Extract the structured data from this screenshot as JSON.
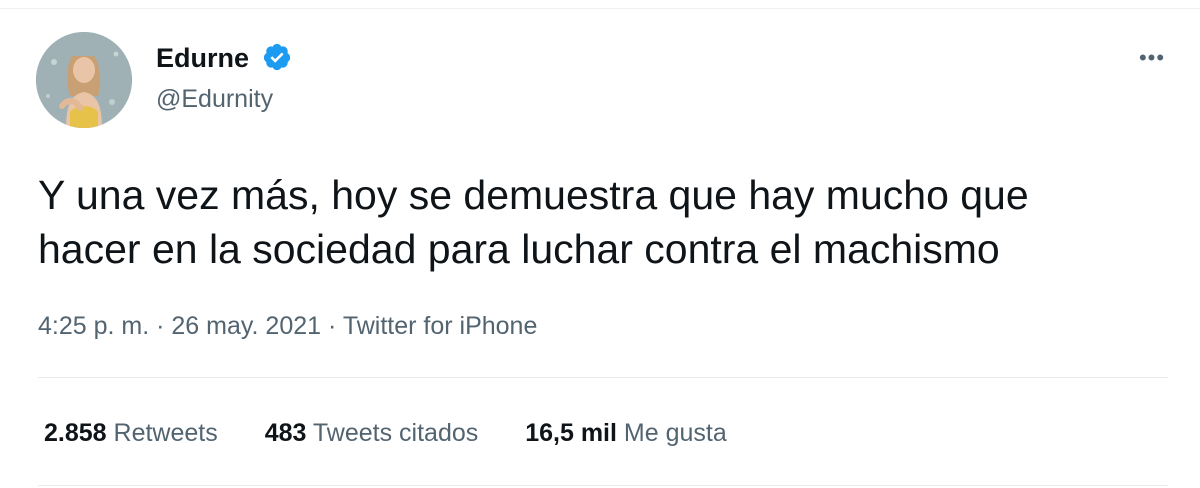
{
  "author": {
    "name": "Edurne",
    "handle": "@Edurnity",
    "verified": true,
    "verified_color": "#1d9bf0"
  },
  "menu_icon": "more-horizontal-icon",
  "tweet": {
    "lines": [
      "Y una vez más, hoy se demuestra que hay mucho que",
      "hacer en la sociedad para luchar contra el machismo"
    ],
    "time": "4:25 p. m.",
    "separator": "·",
    "date": "26 may. 2021",
    "source": "Twitter for iPhone"
  },
  "stats": [
    {
      "value": "2.858",
      "label": "Retweets"
    },
    {
      "value": "483",
      "label": "Tweets citados"
    },
    {
      "value": "16,5 mil",
      "label": "Me gusta"
    }
  ],
  "colors": {
    "text_primary": "#0f1419",
    "text_secondary": "#536471",
    "divider": "#e6ecf0"
  }
}
